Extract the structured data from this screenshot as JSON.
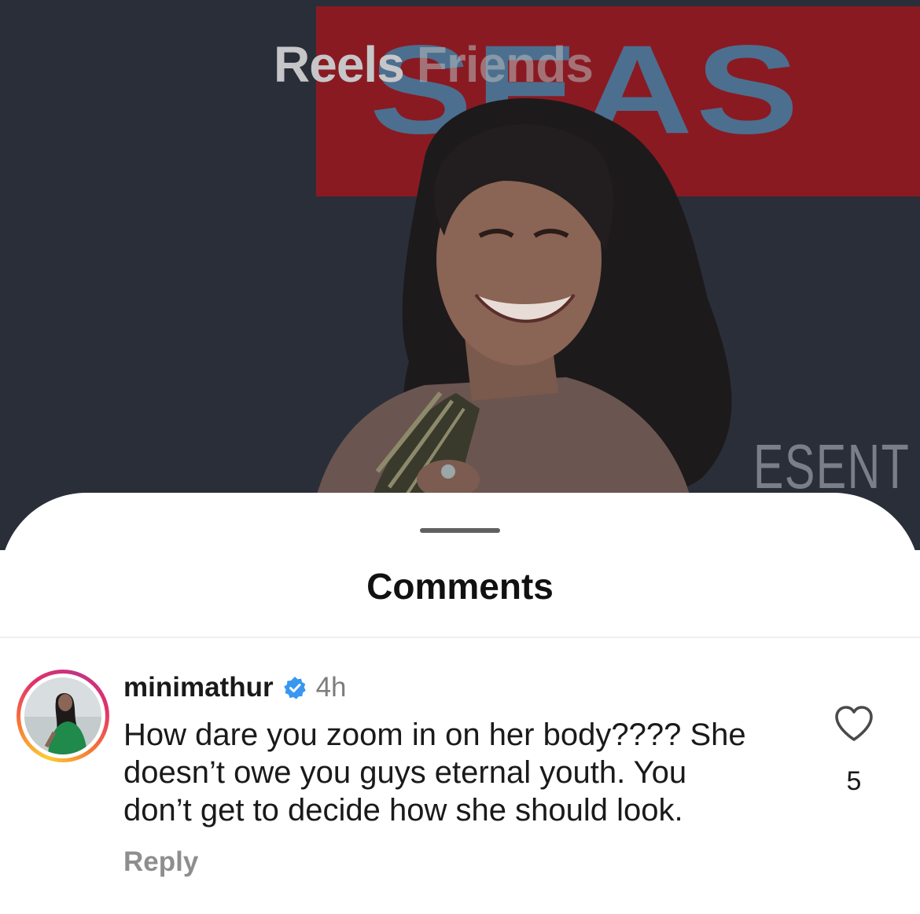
{
  "reel": {
    "tabs": [
      {
        "label": "Reels",
        "active": true
      },
      {
        "label": "Friends",
        "active": false
      }
    ],
    "backdrop_text": "ESENT"
  },
  "comments_sheet": {
    "title": "Comments",
    "comments": [
      {
        "username": "minimathur",
        "verified": true,
        "time": "4h",
        "text_lines": [
          "How dare you zoom in on her body???? She",
          "doesn’t owe you guys eternal youth. You",
          "don’t get to decide how she should look."
        ],
        "like_count": "5",
        "reply_label": "Reply"
      }
    ]
  },
  "colors": {
    "story_ring": [
      "#f9ce34",
      "#ee2a7b",
      "#6228d7"
    ],
    "verified_badge": "#3897f0"
  },
  "icons": [
    "heart-icon",
    "verified-badge-icon"
  ]
}
